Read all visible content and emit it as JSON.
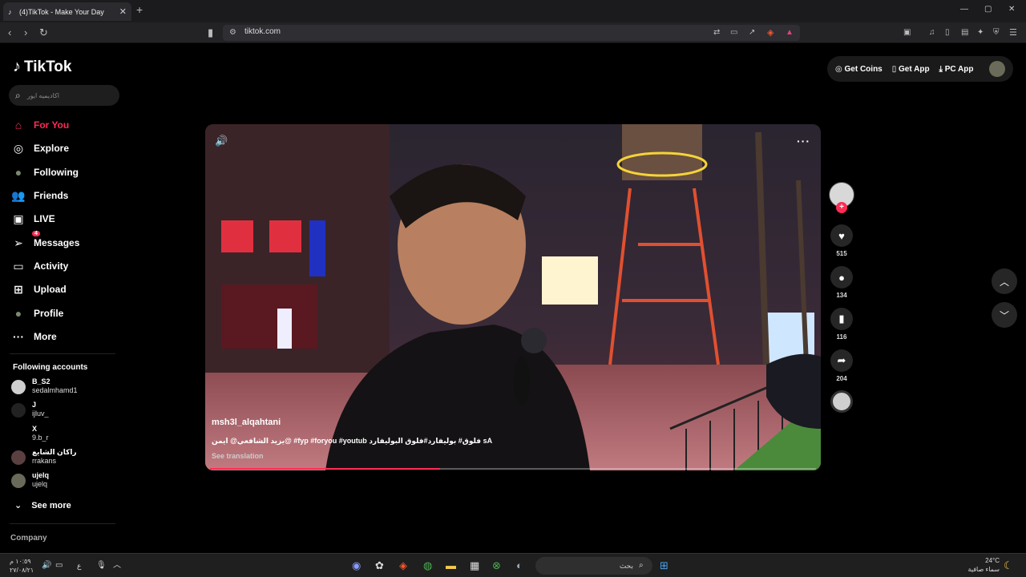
{
  "browser": {
    "tab_title": "(4)TikTok - Make Your Day",
    "new_tab": "+",
    "tab_close": "✕",
    "url": "tiktok.com",
    "window": {
      "minimize": "—",
      "maximize": "▢",
      "close": "✕"
    }
  },
  "sidebar": {
    "logo": "TikTok",
    "search_placeholder": "اكاديميه ايور",
    "nav": [
      {
        "label": "For You",
        "icon": "home-icon",
        "glyph": "⌂"
      },
      {
        "label": "Explore",
        "icon": "compass-icon",
        "glyph": "◎"
      },
      {
        "label": "Following",
        "icon": "following-avatar-icon",
        "glyph": "●"
      },
      {
        "label": "Friends",
        "icon": "friends-icon",
        "glyph": "👥"
      },
      {
        "label": "LIVE",
        "icon": "live-icon",
        "glyph": "▣"
      },
      {
        "label": "Messages",
        "icon": "messages-icon",
        "glyph": "➢",
        "badge": "4"
      },
      {
        "label": "Activity",
        "icon": "activity-icon",
        "glyph": "▭"
      },
      {
        "label": "Upload",
        "icon": "upload-icon",
        "glyph": "⊞"
      },
      {
        "label": "Profile",
        "icon": "profile-avatar-icon",
        "glyph": "●"
      },
      {
        "label": "More",
        "icon": "more-icon",
        "glyph": "···"
      }
    ],
    "following_title": "Following accounts",
    "accounts": [
      {
        "name": "B_S2",
        "handle": "sedalmhamd1"
      },
      {
        "name": "J",
        "handle": "ijluv_"
      },
      {
        "name": "X",
        "handle": "9.b_r"
      },
      {
        "name": "راكان الشايع",
        "handle": "rrakans"
      },
      {
        "name": "ujelq",
        "handle": "ujelq"
      }
    ],
    "see_more": "See more",
    "company": "Company"
  },
  "header": {
    "get_coins": "Get Coins",
    "get_app": "Get App",
    "pc_app": "PC App"
  },
  "video": {
    "author": "msh3l_alqahtani",
    "caption": "یزید الشافعي@ ايمن@ #fyp #foryou #youtub فلوق# بوليفارد#فلوق البوليفارد",
    "caption_end": "sA",
    "see_translation": "See translation",
    "progress": 0.38
  },
  "actions": {
    "likes": "515",
    "comments": "134",
    "saves": "116",
    "shares": "204"
  },
  "taskbar": {
    "search": "بحث",
    "weather_temp": "24°C",
    "weather_desc": "سماء صافية",
    "time": "١٠:٥٩ م",
    "date": "٢٧/٠٨/٢١",
    "lang": "ع"
  },
  "colors": {
    "accent": "#fe2c55",
    "background": "#000000",
    "panel": "#1a1a1a"
  }
}
